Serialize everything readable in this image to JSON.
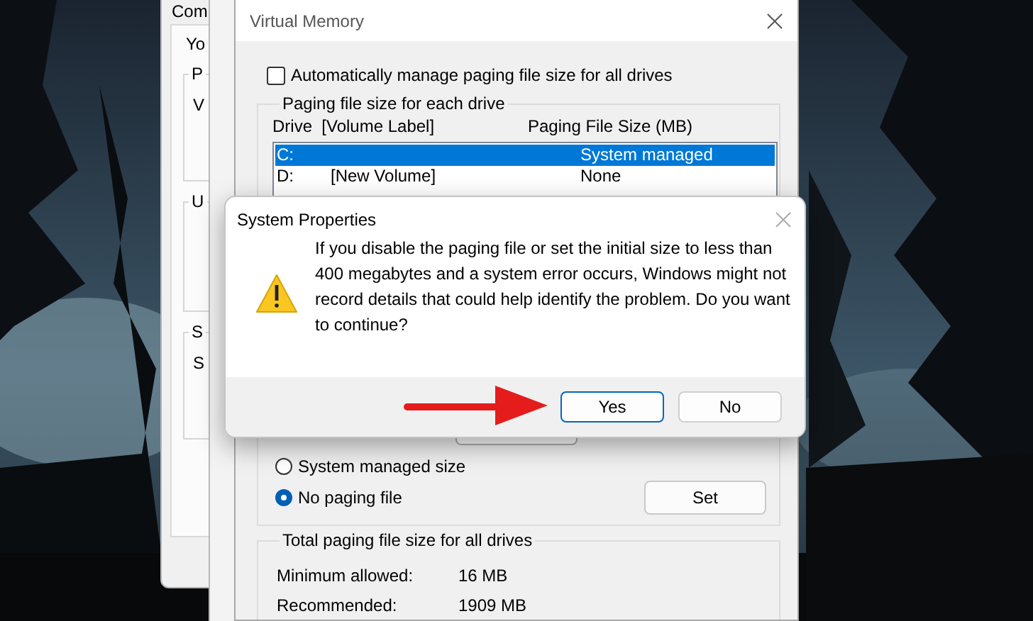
{
  "background_window": {
    "tab": "Com",
    "intro": "Yo",
    "groups": [
      {
        "legend": "P",
        "text": "V"
      },
      {
        "legend": "U"
      },
      {
        "legend": "S",
        "text": "S"
      }
    ]
  },
  "virtual_memory": {
    "title": "Virtual Memory",
    "auto_manage": {
      "label": "Automatically manage paging file size for all drives",
      "checked": false
    },
    "drives_group": {
      "title": "Paging file size for each drive",
      "columns": [
        "Drive  [Volume Label]",
        "Paging File Size (MB)"
      ],
      "rows": [
        {
          "drive": "C:",
          "size": "System managed",
          "selected": true
        },
        {
          "drive": "D:",
          "volume_label": "[New Volume]",
          "size": "None",
          "selected": false
        }
      ],
      "size_options": [
        {
          "label": "System managed size",
          "selected": false
        },
        {
          "label": "No paging file",
          "selected": true
        }
      ],
      "set_button": "Set"
    },
    "totals": {
      "title": "Total paging file size for all drives",
      "rows": [
        {
          "label": "Minimum allowed:",
          "value": "16 MB"
        },
        {
          "label": "Recommended:",
          "value": "1909 MB"
        }
      ]
    }
  },
  "dialog": {
    "title": "System Properties",
    "message": "If you disable the paging file or set the initial size to less than 400 megabytes and a system error occurs, Windows might not record details that could help identify the problem. Do you want to continue?",
    "buttons": [
      {
        "label": "Yes",
        "default": true
      },
      {
        "label": "No",
        "default": false
      }
    ]
  }
}
